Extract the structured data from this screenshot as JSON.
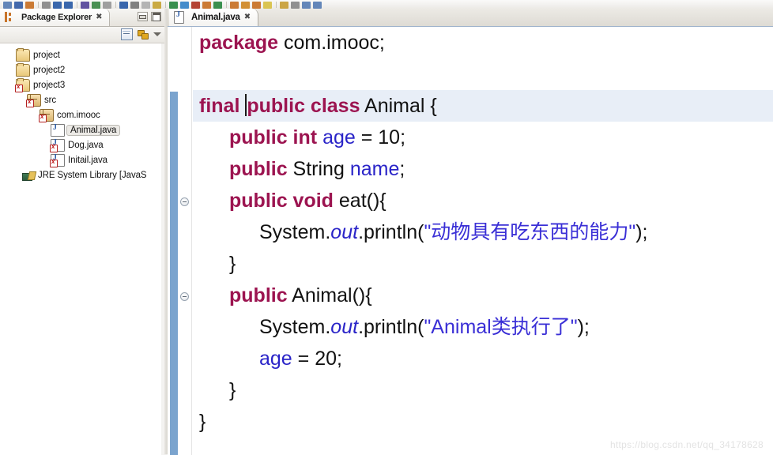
{
  "toolbar": {
    "icon_colors": [
      "#5b7fb5",
      "#3a62a8",
      "#c8742a",
      "#8a8a8a",
      "#2f5fa8",
      "#2f5fa8",
      "#5a4a9c",
      "#3f8a4a",
      "#9a9a9a",
      "#2f5fa8",
      "#7a7a7a",
      "#b0b0b0",
      "#c7a53a",
      "#2f8a46",
      "#3a86c8",
      "#b03a2a",
      "#c8742a",
      "#2f8a46",
      "#c8742a",
      "#d08a2a",
      "#c8742a",
      "#d8c24a",
      "#c8a03a",
      "#8a8a8a",
      "#5b7fb5",
      "#5b7fb5"
    ],
    "icon_name": "toolbar-icon"
  },
  "package_explorer": {
    "tab_label": "Package Explorer",
    "tab_close": "✖",
    "icons": {
      "view": "package-explorer-icon",
      "minimize": "minimize-icon",
      "maximize": "maximize-icon",
      "collapse_all": "collapse-all-icon",
      "link_with_editor": "link-with-editor-icon",
      "view_menu": "view-menu-icon"
    },
    "tree": [
      {
        "label": "project",
        "icon": "project-folder-icon",
        "indent": "ind1",
        "selected": false,
        "error": false
      },
      {
        "label": "project2",
        "icon": "project-folder-icon",
        "indent": "ind1",
        "selected": false,
        "error": false
      },
      {
        "label": "project3",
        "icon": "project-folder-icon",
        "indent": "ind1",
        "selected": false,
        "error": true
      },
      {
        "label": "src",
        "icon": "source-folder-icon",
        "indent": "ind2",
        "selected": false,
        "error": true
      },
      {
        "label": "com.imooc",
        "icon": "package-icon",
        "indent": "ind3",
        "selected": false,
        "error": true
      },
      {
        "label": "Animal.java",
        "icon": "java-file-icon",
        "indent": "ind4",
        "selected": true,
        "error": false
      },
      {
        "label": "Dog.java",
        "icon": "java-file-error-icon",
        "indent": "ind4",
        "selected": false,
        "error": true
      },
      {
        "label": "Initail.java",
        "icon": "java-file-error-icon",
        "indent": "ind4",
        "selected": false,
        "error": true
      },
      {
        "label": "JRE System Library [JavaS",
        "icon": "jre-library-icon",
        "indent": "ind-jre",
        "selected": false,
        "error": false
      }
    ]
  },
  "editor": {
    "tab_label": "Animal.java",
    "tab_close": "✖",
    "tab_icon": "java-file-icon",
    "file_name": "Animal.java",
    "lines": [
      {
        "indent": 0,
        "tokens": [
          {
            "t": "kw",
            "v": "package"
          },
          {
            "t": "plain",
            "v": " com.imooc;"
          }
        ],
        "current": false,
        "fold": false
      },
      {
        "indent": 0,
        "tokens": [],
        "current": false,
        "fold": false
      },
      {
        "indent": 0,
        "tokens": [
          {
            "t": "kw",
            "v": "final"
          },
          {
            "t": "plain",
            "v": " "
          },
          {
            "t": "caret",
            "v": ""
          },
          {
            "t": "kw",
            "v": "public class"
          },
          {
            "t": "plain",
            "v": " Animal {"
          }
        ],
        "current": true,
        "fold": false
      },
      {
        "indent": 1,
        "tokens": [
          {
            "t": "kw",
            "v": "public int"
          },
          {
            "t": "plain",
            "v": " "
          },
          {
            "t": "fld",
            "v": "age"
          },
          {
            "t": "plain",
            "v": " = 10;"
          }
        ],
        "current": false,
        "fold": false
      },
      {
        "indent": 1,
        "tokens": [
          {
            "t": "kw",
            "v": "public"
          },
          {
            "t": "plain",
            "v": " String "
          },
          {
            "t": "fld",
            "v": "name"
          },
          {
            "t": "plain",
            "v": ";"
          }
        ],
        "current": false,
        "fold": false
      },
      {
        "indent": 1,
        "tokens": [
          {
            "t": "kw",
            "v": "public void"
          },
          {
            "t": "plain",
            "v": " eat(){"
          }
        ],
        "current": false,
        "fold": true
      },
      {
        "indent": 2,
        "tokens": [
          {
            "t": "plain",
            "v": "System."
          },
          {
            "t": "stat",
            "v": "out"
          },
          {
            "t": "plain",
            "v": ".println("
          },
          {
            "t": "str",
            "v": "\"动物具有吃东西的能力\""
          },
          {
            "t": "plain",
            "v": ");"
          }
        ],
        "current": false,
        "fold": false
      },
      {
        "indent": 1,
        "tokens": [
          {
            "t": "plain",
            "v": "}"
          }
        ],
        "current": false,
        "fold": false
      },
      {
        "indent": 1,
        "tokens": [
          {
            "t": "kw",
            "v": "public"
          },
          {
            "t": "plain",
            "v": " Animal(){"
          }
        ],
        "current": false,
        "fold": true
      },
      {
        "indent": 2,
        "tokens": [
          {
            "t": "plain",
            "v": "System."
          },
          {
            "t": "stat",
            "v": "out"
          },
          {
            "t": "plain",
            "v": ".println("
          },
          {
            "t": "str",
            "v": "\"Animal类执行了\""
          },
          {
            "t": "plain",
            "v": ");"
          }
        ],
        "current": false,
        "fold": false
      },
      {
        "indent": 2,
        "tokens": [
          {
            "t": "fld",
            "v": "age"
          },
          {
            "t": "plain",
            "v": " = 20;"
          }
        ],
        "current": false,
        "fold": false
      },
      {
        "indent": 1,
        "tokens": [
          {
            "t": "plain",
            "v": "}"
          }
        ],
        "current": false,
        "fold": false
      },
      {
        "indent": 0,
        "tokens": [
          {
            "t": "plain",
            "v": "}"
          }
        ],
        "current": false,
        "fold": false
      }
    ],
    "colors": {
      "keyword": "#9c1450",
      "field": "#2a24c8",
      "string": "#3a2fd6",
      "plain": "#121212",
      "current_line": "#e8eef7",
      "change_bar": "#7ba4ce"
    }
  },
  "watermark": {
    "text": "https://blog.csdn.net/qq_34178628"
  }
}
